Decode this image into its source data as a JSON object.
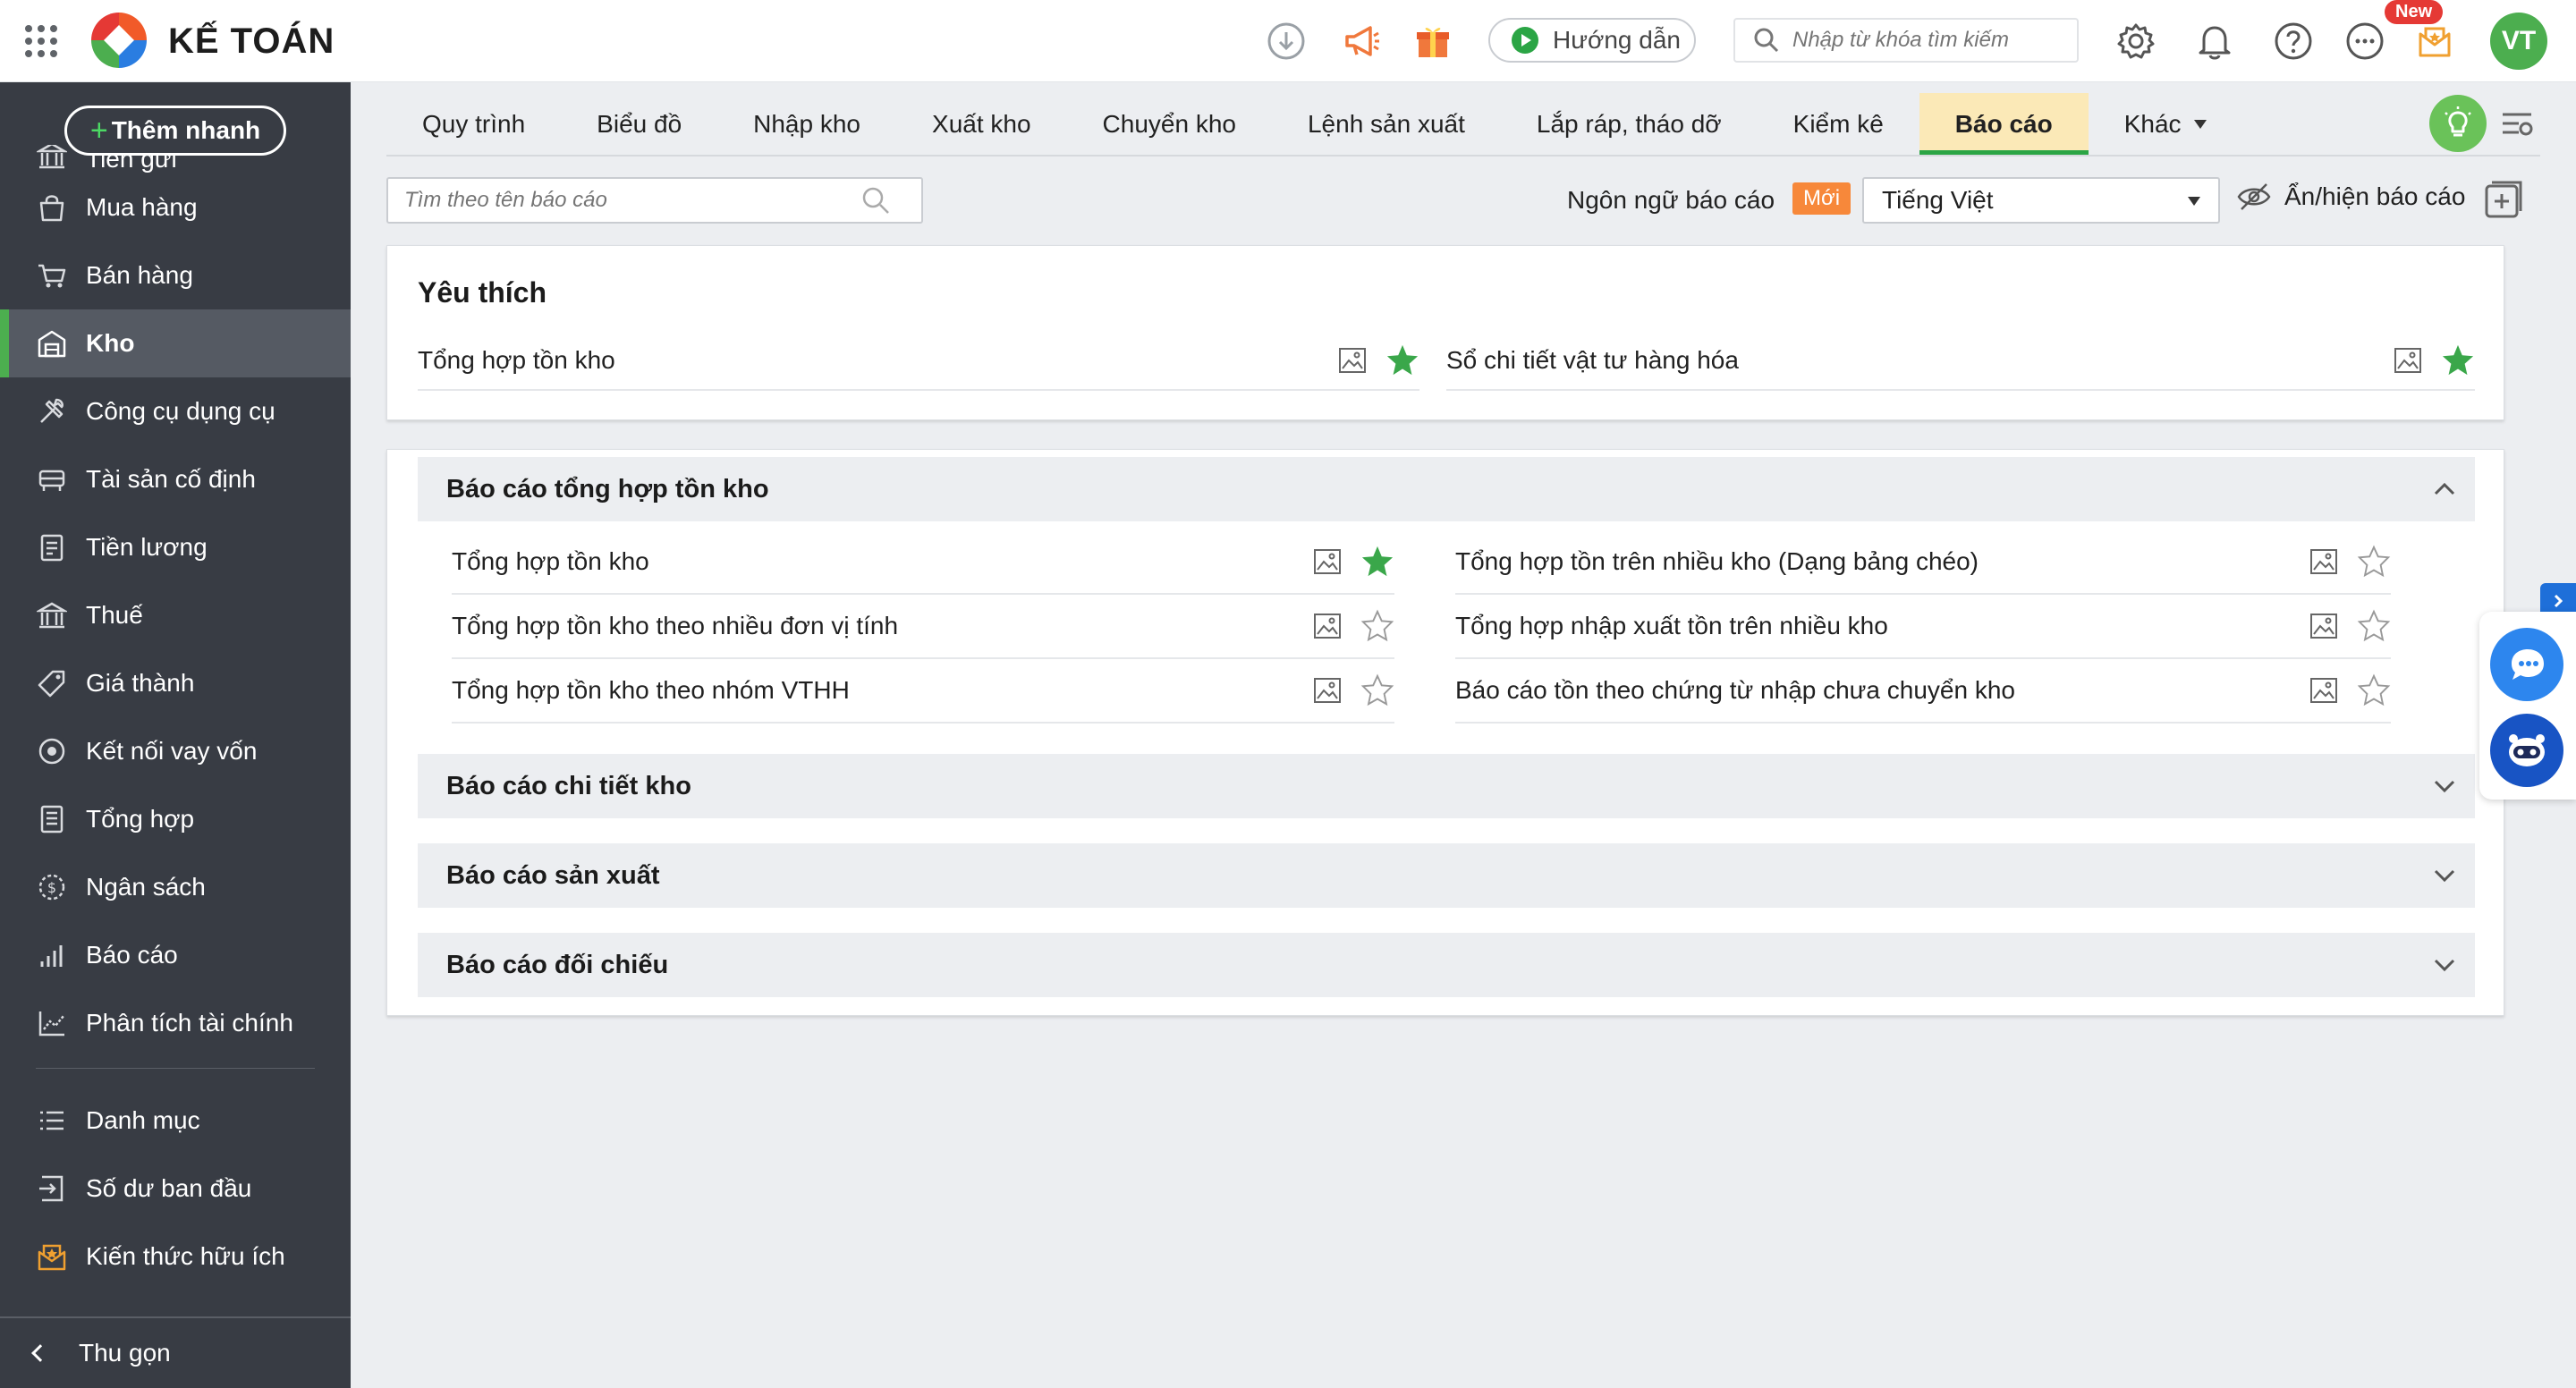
{
  "app": {
    "title": "KẾ TOÁN"
  },
  "topbar": {
    "guide_label": "Hướng dẫn",
    "search_placeholder": "Nhập từ khóa tìm kiếm",
    "new_badge": "New",
    "avatar_initials": "VT"
  },
  "sidebar": {
    "quick_add_label": "Thêm nhanh",
    "items": [
      {
        "label": "Tiền gửi",
        "icon": "bank-icon"
      },
      {
        "label": "Mua hàng",
        "icon": "shopping-bag-icon"
      },
      {
        "label": "Bán hàng",
        "icon": "cart-icon"
      },
      {
        "label": "Kho",
        "icon": "warehouse-icon"
      },
      {
        "label": "Công cụ dụng cụ",
        "icon": "tools-icon"
      },
      {
        "label": "Tài sản cố định",
        "icon": "asset-icon"
      },
      {
        "label": "Tiền lương",
        "icon": "payroll-icon"
      },
      {
        "label": "Thuế",
        "icon": "tax-icon"
      },
      {
        "label": "Giá thành",
        "icon": "price-tag-icon"
      },
      {
        "label": "Kết nối vay vốn",
        "icon": "loan-icon"
      },
      {
        "label": "Tổng hợp",
        "icon": "summary-icon"
      },
      {
        "label": "Ngân sách",
        "icon": "budget-icon"
      },
      {
        "label": "Báo cáo",
        "icon": "bar-chart-icon"
      },
      {
        "label": "Phân tích tài chính",
        "icon": "analysis-icon"
      }
    ],
    "bottom_items": [
      {
        "label": "Danh mục",
        "icon": "list-icon"
      },
      {
        "label": "Số dư ban đầu",
        "icon": "opening-balance-icon"
      },
      {
        "label": "Kiến thức hữu ích",
        "icon": "knowledge-icon"
      }
    ],
    "collapse_label": "Thu gọn",
    "active_item": "Kho"
  },
  "tabs": [
    {
      "label": "Quy trình"
    },
    {
      "label": "Biểu đồ"
    },
    {
      "label": "Nhập kho"
    },
    {
      "label": "Xuất kho"
    },
    {
      "label": "Chuyển kho"
    },
    {
      "label": "Lệnh sản xuất"
    },
    {
      "label": "Lắp ráp, tháo dỡ"
    },
    {
      "label": "Kiểm kê"
    },
    {
      "label": "Báo cáo"
    },
    {
      "label": "Khác"
    }
  ],
  "active_tab": "Báo cáo",
  "filters": {
    "report_search_placeholder": "Tìm theo tên báo cáo",
    "language_label": "Ngôn ngữ báo cáo",
    "new_badge": "Mới",
    "language_value": "Tiếng Việt",
    "toggle_reports_label": "Ẩn/hiện báo cáo"
  },
  "favorites": {
    "title": "Yêu thích",
    "items": [
      {
        "label": "Tổng hợp tồn kho",
        "starred": true
      },
      {
        "label": "Sổ chi tiết vật tư hàng hóa",
        "starred": true
      }
    ]
  },
  "groups": [
    {
      "title": "Báo cáo tổng hợp tồn kho",
      "expanded": true,
      "items": [
        {
          "label": "Tổng hợp tồn kho",
          "starred": true
        },
        {
          "label": "Tổng hợp tồn trên nhiều kho (Dạng bảng chéo)",
          "starred": false
        },
        {
          "label": "Tổng hợp tồn kho theo nhiều đơn vị tính",
          "starred": false
        },
        {
          "label": "Tổng hợp nhập xuất tồn trên nhiều kho",
          "starred": false
        },
        {
          "label": "Tổng hợp tồn kho theo nhóm VTHH",
          "starred": false
        },
        {
          "label": "Báo cáo tồn theo chứng từ nhập chưa chuyển kho",
          "starred": false
        }
      ]
    },
    {
      "title": "Báo cáo chi tiết kho",
      "expanded": false
    },
    {
      "title": "Báo cáo sản xuất",
      "expanded": false
    },
    {
      "title": "Báo cáo đối chiếu",
      "expanded": false
    }
  ],
  "colors": {
    "sidebar_bg": "#383c44",
    "accent_green": "#2ba545",
    "active_tab_bg": "#fbe9b7",
    "badge_orange": "#f7883a",
    "star_green": "#3aa74a"
  }
}
